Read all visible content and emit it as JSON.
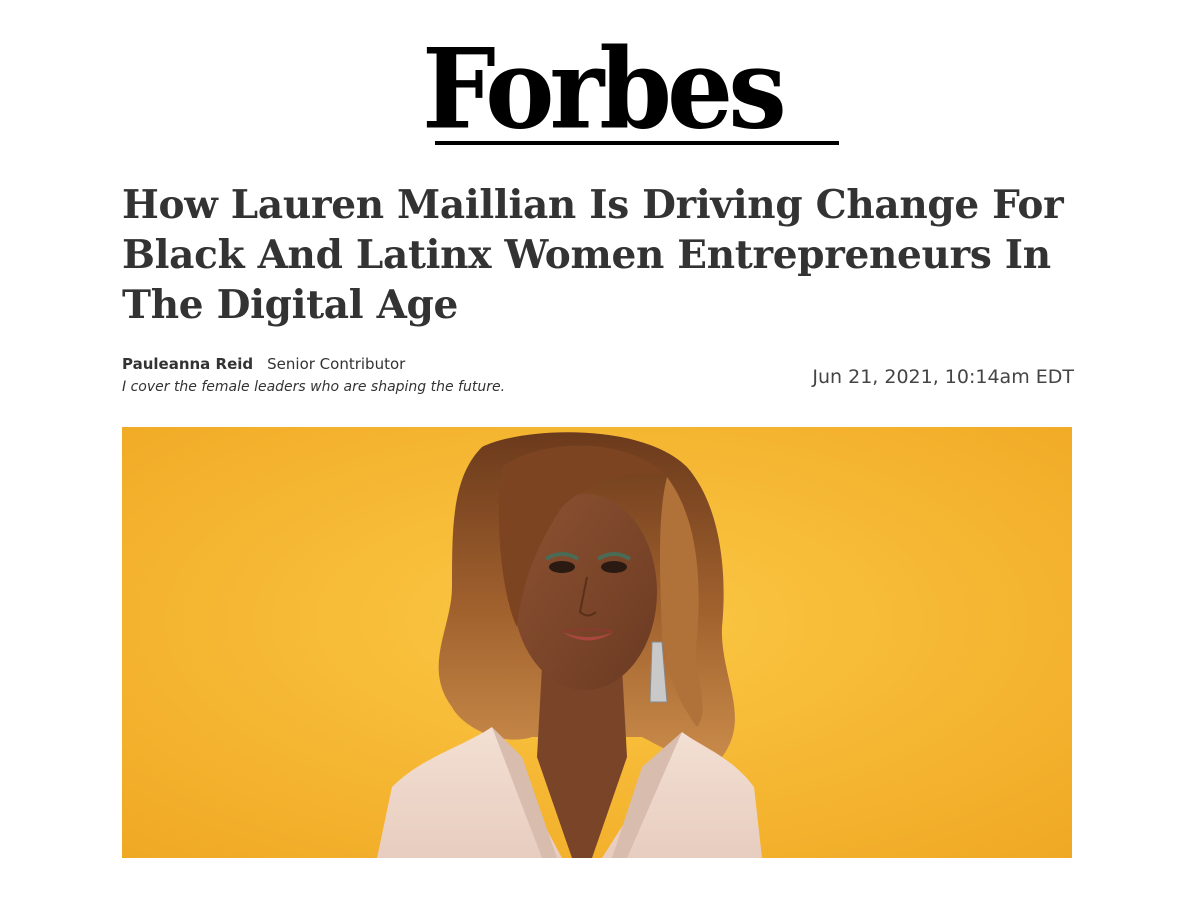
{
  "brand": {
    "logo_text": "Forbes"
  },
  "article": {
    "headline": "How Lauren Maillian Is Driving Change For Black And Latinx Women Entrepreneurs In The Digital Age",
    "author": "Pauleanna Reid",
    "author_role": "Senior Contributor",
    "author_tagline": "I cover the female leaders who are shaping the future.",
    "published": "Jun 21, 2021, 10:14am EDT"
  },
  "hero_image": {
    "subject": "portrait-photo",
    "background_color": "#f4b52c"
  },
  "colors": {
    "text": "#333333",
    "logo": "#000000",
    "date": "#444444"
  }
}
